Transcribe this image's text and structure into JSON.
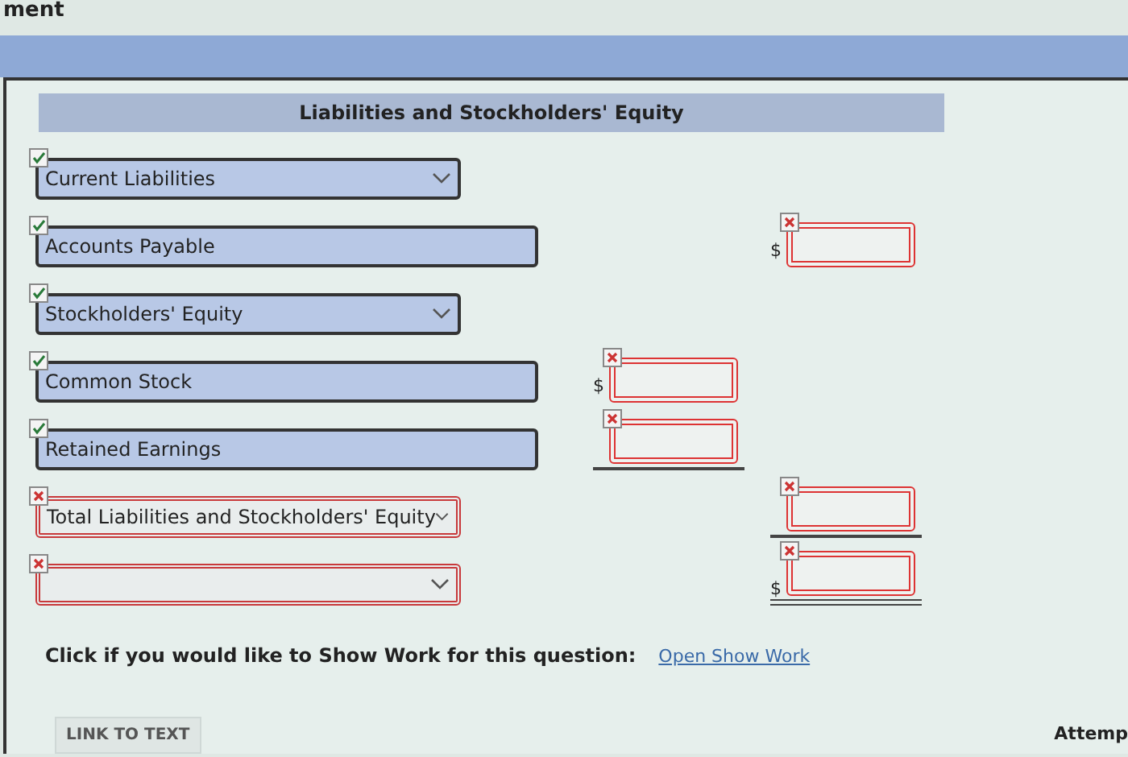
{
  "page_title": "ment",
  "section_title": "Liabilities and Stockholders' Equity",
  "rows": [
    {
      "kind": "select",
      "value": "Current Liabilities",
      "correct": true
    },
    {
      "kind": "input",
      "value": "Accounts Payable",
      "correct": true,
      "amount": {
        "kind": "total",
        "dollar": "$",
        "correct": false
      }
    },
    {
      "kind": "select",
      "value": "Stockholders' Equity",
      "correct": true
    },
    {
      "kind": "input",
      "value": "Common Stock",
      "correct": true,
      "amount": {
        "kind": "detail",
        "dollar": "$",
        "correct": false
      }
    },
    {
      "kind": "input",
      "value": "Retained Earnings",
      "correct": true,
      "amount": {
        "kind": "detail",
        "correct": false,
        "underline": true
      }
    },
    {
      "kind": "select",
      "value": "Total Liabilities and Stockholders' Equity",
      "correct": false,
      "amount": {
        "kind": "total",
        "correct": false,
        "underline": true
      }
    },
    {
      "kind": "select",
      "correct": false,
      "amount": {
        "kind": "total",
        "dollar": "$",
        "correct": false,
        "double_underline": true
      }
    }
  ],
  "show_work": {
    "prompt": "Click if you would like to Show Work for this question:",
    "link": "Open Show Work"
  },
  "link_button": "LINK TO TEXT",
  "footer_text": "Attemp"
}
